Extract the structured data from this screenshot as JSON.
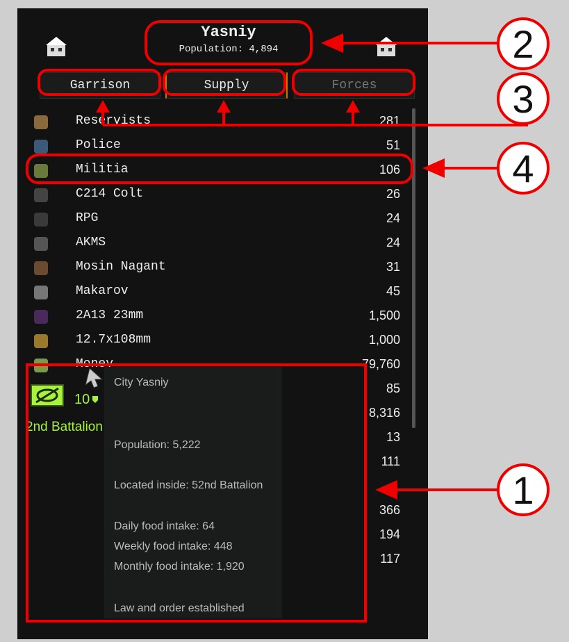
{
  "header": {
    "city_name": "Yasniy",
    "population_label": "Population: 4,894",
    "left_icon": "city-building-icon",
    "right_icon": "city-building-icon"
  },
  "tabs": [
    {
      "label": "Garrison",
      "state": "normal"
    },
    {
      "label": "Supply",
      "state": "active"
    },
    {
      "label": "Forces",
      "state": "disabled"
    }
  ],
  "items": [
    {
      "name": "Reservists",
      "value": "281",
      "icon": "soldier-icon"
    },
    {
      "name": "Police",
      "value": "51",
      "icon": "police-icon"
    },
    {
      "name": "Militia",
      "value": "106",
      "icon": "militia-helmet-icon"
    },
    {
      "name": "C214 Colt",
      "value": "26",
      "icon": "rifle-icon"
    },
    {
      "name": "RPG",
      "value": "24",
      "icon": "rpg-icon"
    },
    {
      "name": "AKMS",
      "value": "24",
      "icon": "assault-rifle-icon"
    },
    {
      "name": "Mosin Nagant",
      "value": "31",
      "icon": "bolt-rifle-icon"
    },
    {
      "name": "Makarov",
      "value": "45",
      "icon": "pistol-icon"
    },
    {
      "name": "2A13 23mm",
      "value": "1,500",
      "icon": "shell-icon"
    },
    {
      "name": "12.7x108mm",
      "value": "1,000",
      "icon": "ammo-icon"
    },
    {
      "name": "Money",
      "value": "79,760",
      "icon": "money-icon"
    },
    {
      "name": "",
      "value": "85",
      "icon": ""
    },
    {
      "name": "",
      "value": "8,316",
      "icon": ""
    },
    {
      "name": "",
      "value": "13",
      "icon": ""
    },
    {
      "name": "",
      "value": "111",
      "icon": ""
    },
    {
      "name": "",
      "value": "",
      "icon": ""
    },
    {
      "name": "",
      "value": "366",
      "icon": ""
    },
    {
      "name": "",
      "value": "194",
      "icon": ""
    },
    {
      "name": "",
      "value": "117",
      "icon": ""
    }
  ],
  "map_unit": {
    "count": "10",
    "label": "2nd Battalion",
    "color": "#a6f23c"
  },
  "tooltip": {
    "title": "City Yasniy",
    "population": "Population: 5,222",
    "located": "Located inside: 52nd Battalion",
    "daily": "Daily food intake: 64",
    "weekly": "Weekly food intake: 448",
    "monthly": "Monthly food intake: 1,920",
    "law": "Law and order established"
  },
  "annotations": {
    "n1": "1",
    "n2": "2",
    "n3": "3",
    "n4": "4",
    "color": "#e00000"
  }
}
